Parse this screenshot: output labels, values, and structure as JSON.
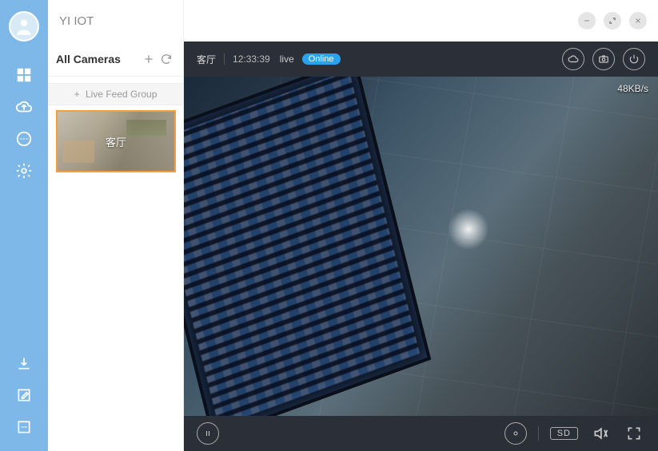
{
  "app": {
    "title": "YI IOT"
  },
  "window_controls": {
    "minimize": "minimize-icon",
    "maximize": "maximize-icon",
    "close": "close-icon"
  },
  "sidebar": {
    "header_label": "All Cameras",
    "add_icon": "plus-icon",
    "refresh_icon": "refresh-icon",
    "group_add_prefix": "+",
    "group_add_label": "Live Feed Group",
    "cameras": [
      {
        "name": "客厅"
      }
    ]
  },
  "nav": {
    "items": [
      {
        "id": "grid",
        "icon": "grid-icon"
      },
      {
        "id": "cloud",
        "icon": "cloud-upload-icon"
      },
      {
        "id": "chat",
        "icon": "chat-icon"
      },
      {
        "id": "gear",
        "icon": "gear-icon"
      }
    ],
    "bottom_items": [
      {
        "id": "download",
        "icon": "download-icon"
      },
      {
        "id": "edit",
        "icon": "edit-icon"
      },
      {
        "id": "more",
        "icon": "more-icon"
      }
    ]
  },
  "video": {
    "camera_name": "客厅",
    "timestamp": "12:33:39",
    "live_label": "live",
    "online_badge": "Online",
    "bitrate": "48KB/s",
    "top_actions": [
      {
        "id": "cloud",
        "icon": "cloud-icon"
      },
      {
        "id": "capture",
        "icon": "camera-icon"
      },
      {
        "id": "power",
        "icon": "power-icon"
      }
    ],
    "bottom_left": {
      "id": "pause",
      "icon": "pause-icon"
    },
    "bottom_right": [
      {
        "id": "record",
        "kind": "ring",
        "icon": "record-icon"
      },
      {
        "id": "quality",
        "kind": "pill",
        "label": "SD"
      },
      {
        "id": "mute",
        "kind": "icon",
        "icon": "mute-icon"
      },
      {
        "id": "fullscreen",
        "kind": "icon",
        "icon": "fullscreen-icon"
      }
    ]
  }
}
